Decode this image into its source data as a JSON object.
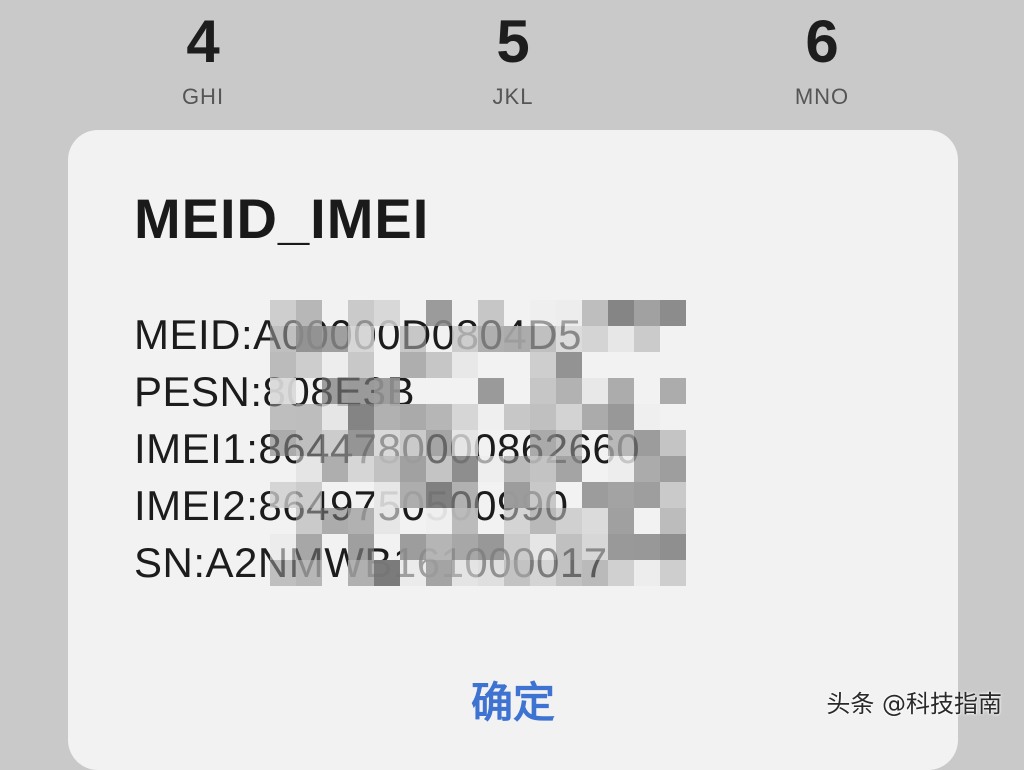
{
  "keypad": {
    "keys": [
      {
        "digit": "4",
        "letters": "GHI"
      },
      {
        "digit": "5",
        "letters": "JKL"
      },
      {
        "digit": "6",
        "letters": "MNO"
      }
    ]
  },
  "dialog": {
    "title": "MEID_IMEI",
    "lines": [
      "MEID:A00000D0804D5",
      "PESN:808E3B",
      "IMEI1:8644780000862660",
      "IMEI2:8649750500990",
      "SN:A2NMWB161000017"
    ],
    "confirm_label": "确定"
  },
  "watermark": "头条 @科技指南",
  "colors": {
    "background": "#c9c9c9",
    "dialog": "#f2f2f2",
    "accent": "#3e73d2"
  }
}
